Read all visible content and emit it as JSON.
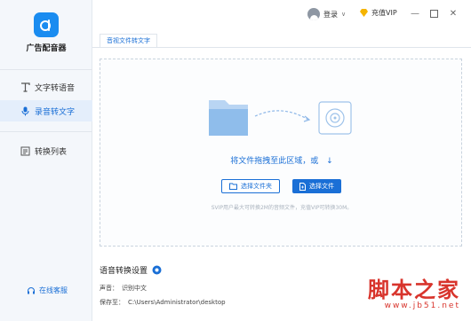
{
  "app": {
    "name": "广告配音器"
  },
  "sidebar": {
    "items": [
      {
        "label": "文字转语音",
        "icon": "text-to-speech-icon",
        "active": false
      },
      {
        "label": "录音转文字",
        "icon": "microphone-icon",
        "active": true
      },
      {
        "label": "转换列表",
        "icon": "list-icon",
        "active": false
      }
    ],
    "service_label": "在线客服",
    "service_icon": "headset-icon"
  },
  "topbar": {
    "login_label": "登录",
    "vip_label": "充值VIP",
    "controls": [
      "minimize",
      "maximize",
      "close"
    ]
  },
  "tabs": [
    {
      "label": "音视文件转文字",
      "active": true
    }
  ],
  "dropzone": {
    "prompt": "将文件拖拽至此区域，或",
    "select_folder_label": "选择文件夹",
    "select_file_label": "选择文件",
    "hint": "SVIP用户最大可转换2M的音频文件，充值VIP可转换30M。"
  },
  "settings": {
    "title": "语音转换设置",
    "voice_label": "声音：",
    "voice_value": "识别中文",
    "save_label": "保存至：",
    "save_path": "C:\\Users\\Administrator\\desktop"
  },
  "watermark": {
    "text": "脚本之家",
    "url": "www.jb51.net"
  },
  "colors": {
    "accent": "#1a6fd6",
    "sidebar_bg": "#f4f7fb",
    "active_bg": "#e4eefb",
    "watermark": "#d8342c"
  }
}
